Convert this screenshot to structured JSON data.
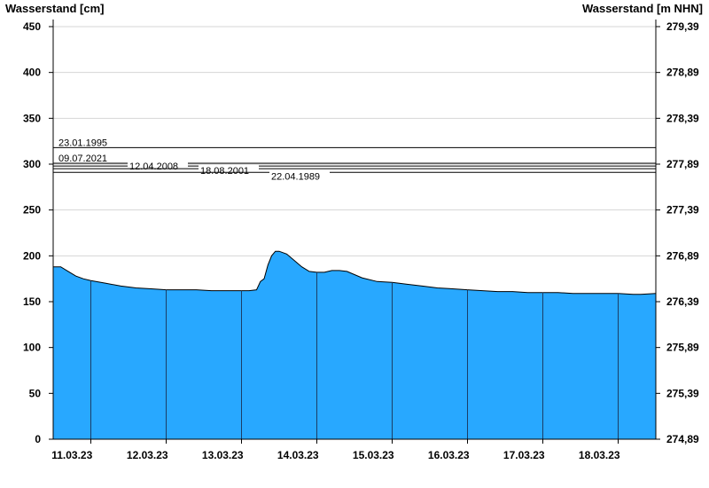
{
  "chart_data": {
    "type": "area",
    "left_axis": {
      "label": "Wasserstand [cm]",
      "ylim": [
        0,
        450
      ],
      "ticks": [
        0,
        50,
        100,
        150,
        200,
        250,
        300,
        350,
        400,
        450
      ],
      "tick_labels": [
        "0",
        "50",
        "100",
        "150",
        "200",
        "250",
        "300",
        "350",
        "400",
        "450"
      ]
    },
    "right_axis": {
      "label": "Wasserstand [m NHN]",
      "ticks": [
        0,
        50,
        100,
        150,
        200,
        250,
        300,
        350,
        400,
        450
      ],
      "tick_labels": [
        "274,89",
        "275,39",
        "275,89",
        "276,39",
        "276,89",
        "277,39",
        "277,89",
        "278,39",
        "278,89",
        "279,39"
      ]
    },
    "x_axis": {
      "range_days": [
        10.5,
        18.5
      ],
      "day_boundaries": [
        11,
        12,
        13,
        14,
        15,
        16,
        17,
        18
      ],
      "categories": [
        "11.03.23",
        "12.03.23",
        "13.03.23",
        "14.03.23",
        "15.03.23",
        "16.03.23",
        "17.03.23",
        "18.03.23"
      ],
      "category_centers": [
        10.75,
        11.75,
        12.75,
        13.75,
        14.75,
        15.75,
        16.75,
        17.75
      ]
    },
    "grid": true,
    "fill_color": "#28A8FF",
    "historic_levels": [
      {
        "date": "23.01.1995",
        "value": 318
      },
      {
        "date": "09.07.2021",
        "value": 301
      },
      {
        "date": "12.04.2008",
        "value": 298
      },
      {
        "date": "18.08.2001",
        "value": 295
      },
      {
        "date": "22.04.1989",
        "value": 291
      }
    ],
    "series": [
      {
        "x": [
          10.5,
          10.6,
          10.7,
          10.8,
          10.9,
          11.0,
          11.2,
          11.4,
          11.6,
          11.8,
          12.0,
          12.2,
          12.4,
          12.6,
          12.8,
          13.0,
          13.1,
          13.2,
          13.25,
          13.3,
          13.35,
          13.4,
          13.45,
          13.5,
          13.6,
          13.7,
          13.8,
          13.9,
          14.0,
          14.1,
          14.2,
          14.3,
          14.4,
          14.6,
          14.8,
          15.0,
          15.2,
          15.4,
          15.6,
          15.8,
          16.0,
          16.2,
          16.4,
          16.6,
          16.8,
          17.0,
          17.2,
          17.4,
          17.6,
          17.8,
          18.0,
          18.2,
          18.3,
          18.5
        ],
        "values": [
          188,
          188,
          183,
          178,
          175,
          173,
          170,
          167,
          165,
          164,
          163,
          163,
          163,
          162,
          162,
          162,
          162,
          163,
          172,
          175,
          190,
          200,
          205,
          205,
          202,
          195,
          188,
          183,
          182,
          182,
          184,
          184,
          183,
          176,
          172,
          171,
          169,
          167,
          165,
          164,
          163,
          162,
          161,
          161,
          160,
          160,
          160,
          159,
          159,
          159,
          159,
          158,
          158,
          159
        ]
      }
    ]
  }
}
